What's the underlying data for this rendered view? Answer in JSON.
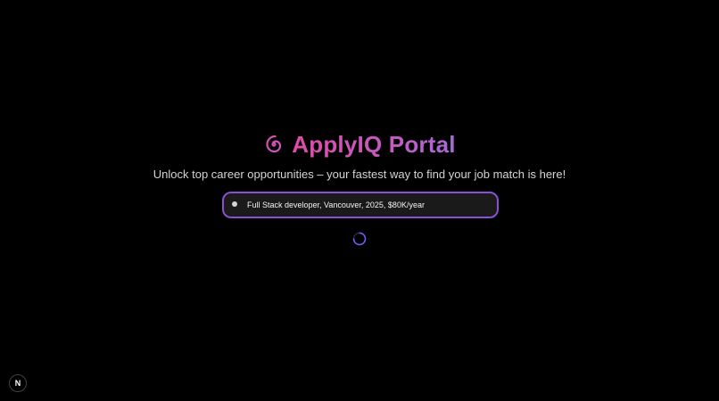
{
  "header": {
    "logo_icon": "spiral-icon",
    "title": "ApplyIQ Portal"
  },
  "tagline": "Unlock top career opportunities – your fastest way to find your job match is here!",
  "search": {
    "icon": "dot-icon",
    "value": "Full Stack developer, Vancouver, 2025, $80K/year",
    "placeholder": ""
  },
  "status": {
    "loading_icon": "loading-spinner-icon"
  },
  "dev_badge": {
    "icon": "nextjs-icon",
    "label": "N"
  },
  "colors": {
    "background": "#000000",
    "title_gradient_start": "#e24aa8",
    "title_gradient_end": "#a46ad6",
    "search_border": "#8b4fd6",
    "search_background": "#1a1a1a",
    "tagline_text": "#d4d4d8"
  }
}
